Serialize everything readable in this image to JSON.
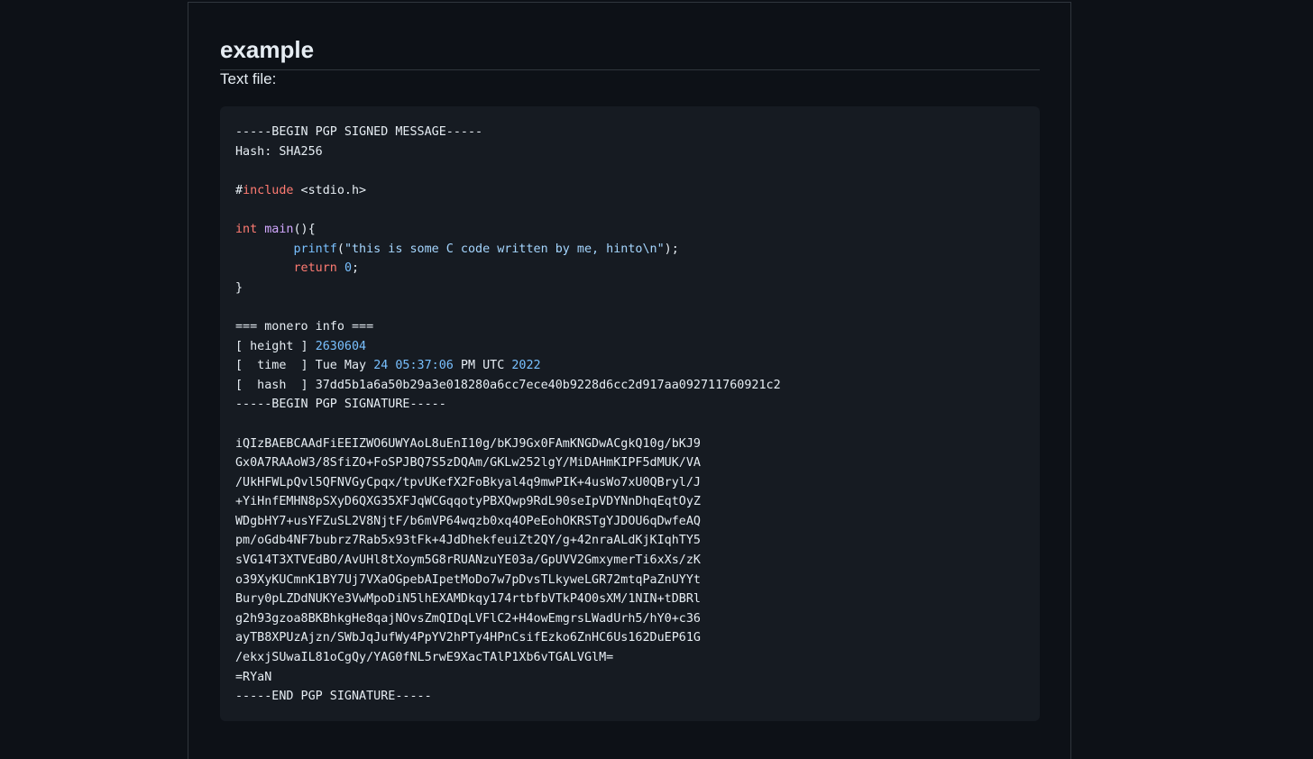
{
  "page": {
    "heading": "example",
    "intro": "Text file:"
  },
  "code": {
    "begin_msg": "-----BEGIN PGP SIGNED MESSAGE-----",
    "hash_line": "Hash: SHA256",
    "include_hash": "#",
    "include_kw": "include",
    "include_rest": " <stdio.h>",
    "main_type": "int",
    "main_name": "main",
    "main_rest": "(){",
    "printf_indent": "        ",
    "printf_name": "printf",
    "printf_open": "(",
    "printf_string": "\"this is some C code written by me, hinto\\n\"",
    "printf_close": ");",
    "return_indent": "        ",
    "return_kw": "return",
    "return_value": "0",
    "return_end": ";",
    "close_brace": "}",
    "monero_header": "=== monero info ===",
    "height_label": "[ height ] ",
    "height_value": "2630604",
    "time_label": "[  time  ] Tue May ",
    "time_day": "24",
    "time_clock": "05:37:06",
    "time_tz": " PM UTC ",
    "time_year": "2022",
    "hash_label": "[  hash  ] ",
    "hash_value": "37dd5b1a6a50b29a3e018280a6cc7ece40b9228d6cc2d917aa092711760921c2",
    "begin_sig": "-----BEGIN PGP SIGNATURE-----",
    "signature_lines": [
      "iQIzBAEBCAAdFiEEIZWO6UWYAoL8uEnI10g/bKJ9Gx0FAmKNGDwACgkQ10g/bKJ9",
      "Gx0A7RAAoW3/8SfiZO+FoSPJBQ7S5zDQAm/GKLw252lgY/MiDAHmKIPF5dMUK/VA",
      "/UkHFWLpQvl5QFNVGyCpqx/tpvUKefX2FoBkyal4q9mwPIK+4usWo7xU0QBryl/J",
      "+YiHnfEMHN8pSXyD6QXG35XFJqWCGqqotyPBXQwp9RdL90seIpVDYNnDhqEqtOyZ",
      "WDgbHY7+usYFZuSL2V8NjtF/b6mVP64wqzb0xq4OPeEohOKRSTgYJDOU6qDwfeAQ",
      "pm/oGdb4NF7bubrz7Rab5x93tFk+4JdDhekfeuiZt2QY/g+42nraALdKjKIqhTY5",
      "sVG14T3XTVEdBO/AvUHl8tXoym5G8rRUANzuYE03a/GpUVV2GmxymerTi6xXs/zK",
      "o39XyKUCmnK1BY7Uj7VXaOGpebAIpetMoDo7w7pDvsTLkyweLGR72mtqPaZnUYYt",
      "Bury0pLZDdNUKYe3VwMpoDiN5lhEXAMDkqy174rtbfbVTkP4O0sXM/1NIN+tDBRl",
      "g2h93gzoa8BKBhkgHe8qajNOvsZmQIDqLVFlC2+H4owEmgrsLWadUrh5/hY0+c36",
      "ayTB8XPUzAjzn/SWbJqJufWy4PpYV2hPTy4HPnCsifEzko6ZnHC6Us162DuEP61G",
      "/ekxjSUwaIL81oCgQy/YAG0fNL5rwE9XacTAlP1Xb6vTGALVGlM=",
      "=RYaN"
    ],
    "end_sig": "-----END PGP SIGNATURE-----"
  }
}
